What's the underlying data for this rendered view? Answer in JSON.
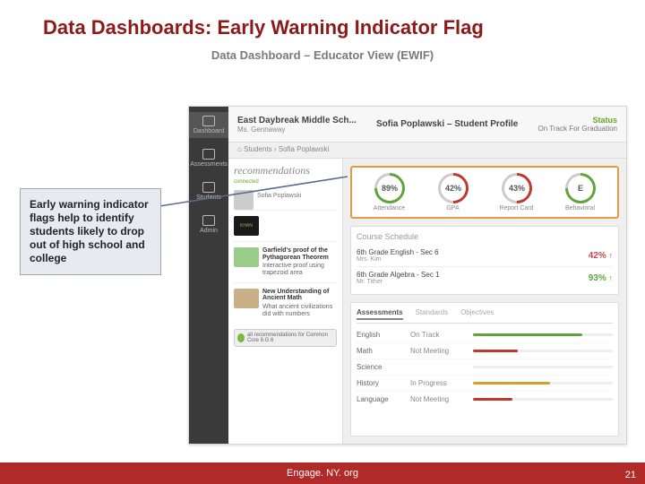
{
  "slide": {
    "title": "Data Dashboards: Early Warning Indicator Flag",
    "subtitle": "Data Dashboard – Educator View (EWIF)",
    "callout": "Early warning indicator flags help to identify students likely to drop out of high school and college",
    "footer": "Engage. NY. org",
    "page": "21"
  },
  "sidebar": {
    "items": [
      {
        "label": "Dashboard"
      },
      {
        "label": "Assessments"
      },
      {
        "label": "Students"
      },
      {
        "label": "Admin"
      }
    ]
  },
  "topbar": {
    "school": "East Daybreak Middle Sch...",
    "teacher": "Ms. Gennaway",
    "profile": "Sofia Poplawski – Student Profile",
    "status_label": "Status",
    "status_value": "On Track For Graduation"
  },
  "crumbs": "⌂ Students  ›  Sofia Poplawski",
  "rec": {
    "heading": "recommendations",
    "connected": "connected",
    "student": "Sofia Poplawski",
    "items": [
      {
        "thumb": "khan",
        "title": "KHAN",
        "body": ""
      },
      {
        "thumb": "",
        "title": "Garfield's proof of the Pythagorean Theorem",
        "body": "Interactive proof using trapezoid area"
      },
      {
        "thumb": "",
        "title": "New Understanding of Ancient Math",
        "body": "What ancient civilizations did with numbers"
      }
    ],
    "button": "all recommendations for Common Core 8.G.6"
  },
  "gauges": [
    {
      "value": "89%",
      "label": "Attendance",
      "cls": "green"
    },
    {
      "value": "42%",
      "label": "GPA",
      "cls": "red"
    },
    {
      "value": "43%",
      "label": "Report Card",
      "cls": "red"
    },
    {
      "value": "E",
      "label": "Behavioral",
      "cls": "green"
    }
  ],
  "schedule": {
    "heading": "Course Schedule",
    "rows": [
      {
        "course": "6th Grade English - Sec 6",
        "teacher": "Mrs. Kim",
        "pct": "42%",
        "cls": "pct-red",
        "arr": "↑"
      },
      {
        "course": "6th Grade Algebra - Sec 1",
        "teacher": "Mr. Tither",
        "pct": "93%",
        "cls": "pct-green",
        "arr": "↑"
      }
    ]
  },
  "assess": {
    "tabs": [
      "Assessments",
      "Standards",
      "Objectives"
    ],
    "rows": [
      {
        "subject": "English",
        "status": "On Track",
        "color": "#5fa53a",
        "w": "78%"
      },
      {
        "subject": "Math",
        "status": "Not Meeting",
        "color": "#c0392b",
        "w": "32%"
      },
      {
        "subject": "Science",
        "status": "",
        "color": "#ddd",
        "w": "0%"
      },
      {
        "subject": "History",
        "status": "In Progress",
        "color": "#d4a02a",
        "w": "55%"
      },
      {
        "subject": "Language",
        "status": "Not Meeting",
        "color": "#c0392b",
        "w": "28%"
      }
    ]
  }
}
